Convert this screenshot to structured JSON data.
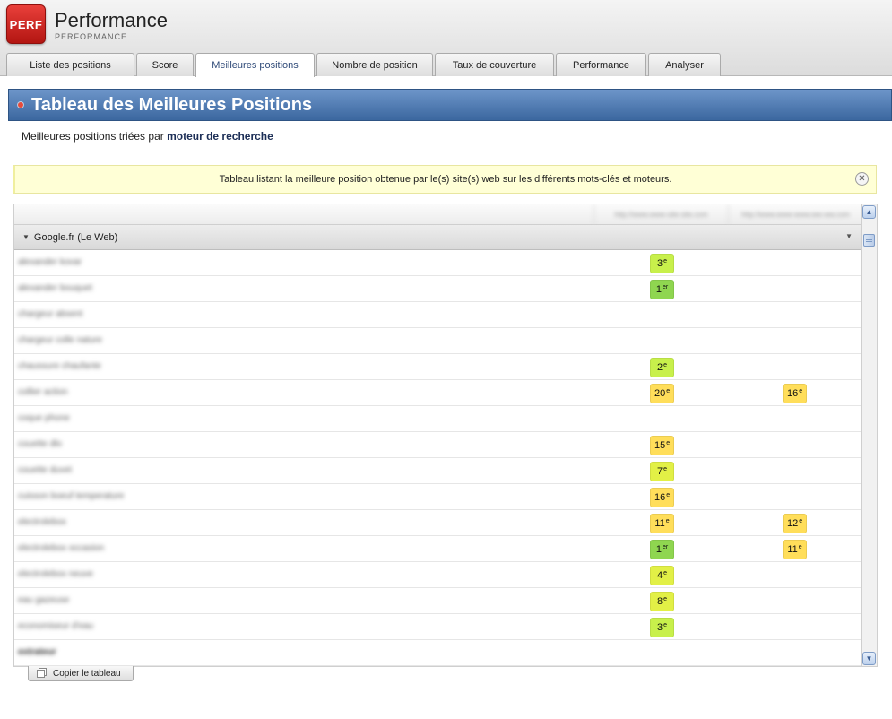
{
  "app": {
    "logo_text": "PERF",
    "title": "Performance",
    "subtitle": "PERFORMANCE"
  },
  "tabs": [
    {
      "label": "Liste des positions",
      "active": false
    },
    {
      "label": "Score",
      "active": false
    },
    {
      "label": "Meilleures positions",
      "active": true
    },
    {
      "label": "Nombre de position",
      "active": false
    },
    {
      "label": "Taux de couverture",
      "active": false
    },
    {
      "label": "Performance",
      "active": false
    },
    {
      "label": "Analyser",
      "active": false
    }
  ],
  "section": {
    "title": "Tableau des Meilleures Positions",
    "sorted_prefix": "Meilleures positions triées par",
    "sorted_by": "moteur de recherche"
  },
  "notice": {
    "text": "Tableau listant la meilleure position obtenue par le(s) site(s) web sur les différents mots-clés et moteurs.",
    "close_icon": "close-circle-icon"
  },
  "table": {
    "columns": [
      "http://www.www-site-site.com",
      "http://www.www-www.ww-ww.com"
    ],
    "group": "Google.fr (Le Web)",
    "rows": [
      {
        "keyword": "alexander kovar",
        "bold": false,
        "cells": [
          {
            "pos": "3",
            "suffix": "e",
            "color": "#c8f04b"
          },
          null
        ]
      },
      {
        "keyword": "alexander bouquet",
        "bold": false,
        "cells": [
          {
            "pos": "1",
            "suffix": "er",
            "color": "#8fd650"
          },
          null
        ]
      },
      {
        "keyword": "chargeur absent",
        "bold": false,
        "cells": [
          null,
          null
        ]
      },
      {
        "keyword": "chargeur colle nature",
        "bold": false,
        "cells": [
          null,
          null
        ]
      },
      {
        "keyword": "chaussure chaufante",
        "bold": false,
        "cells": [
          {
            "pos": "2",
            "suffix": "e",
            "color": "#c8f04b"
          },
          null
        ]
      },
      {
        "keyword": "collier action",
        "bold": false,
        "cells": [
          {
            "pos": "20",
            "suffix": "e",
            "color": "#ffde5a"
          },
          {
            "pos": "16",
            "suffix": "e",
            "color": "#ffde5a"
          }
        ]
      },
      {
        "keyword": "coque phone",
        "bold": false,
        "cells": [
          null,
          null
        ]
      },
      {
        "keyword": "couette dlo",
        "bold": false,
        "cells": [
          {
            "pos": "15",
            "suffix": "e",
            "color": "#ffde5a"
          },
          null
        ]
      },
      {
        "keyword": "couette duvet",
        "bold": false,
        "cells": [
          {
            "pos": "7",
            "suffix": "e",
            "color": "#e2f046"
          },
          null
        ]
      },
      {
        "keyword": "cuisson boeuf temperature",
        "bold": false,
        "cells": [
          {
            "pos": "16",
            "suffix": "e",
            "color": "#ffde5a"
          },
          null
        ]
      },
      {
        "keyword": "electrolebox",
        "bold": false,
        "cells": [
          {
            "pos": "11",
            "suffix": "e",
            "color": "#ffde5a"
          },
          {
            "pos": "12",
            "suffix": "e",
            "color": "#ffde5a"
          }
        ]
      },
      {
        "keyword": "electrolebox occasion",
        "bold": false,
        "cells": [
          {
            "pos": "1",
            "suffix": "er",
            "color": "#8fd650"
          },
          {
            "pos": "11",
            "suffix": "e",
            "color": "#ffde5a"
          }
        ]
      },
      {
        "keyword": "electrolebox neuve",
        "bold": false,
        "cells": [
          {
            "pos": "4",
            "suffix": "e",
            "color": "#e2f046"
          },
          null
        ]
      },
      {
        "keyword": "eau gazeuse",
        "bold": false,
        "cells": [
          {
            "pos": "8",
            "suffix": "e",
            "color": "#e2f046"
          },
          null
        ]
      },
      {
        "keyword": "economiseur d'eau",
        "bold": false,
        "cells": [
          {
            "pos": "3",
            "suffix": "e",
            "color": "#c8f04b"
          },
          null
        ]
      },
      {
        "keyword": "extrateur",
        "bold": true,
        "cells": [
          null,
          null
        ]
      }
    ]
  },
  "copy_button": {
    "label": "Copier le tableau",
    "icon": "copy-icon"
  },
  "scrollbar": {
    "up_icon": "arrow-up-icon",
    "down_icon": "arrow-down-icon"
  }
}
